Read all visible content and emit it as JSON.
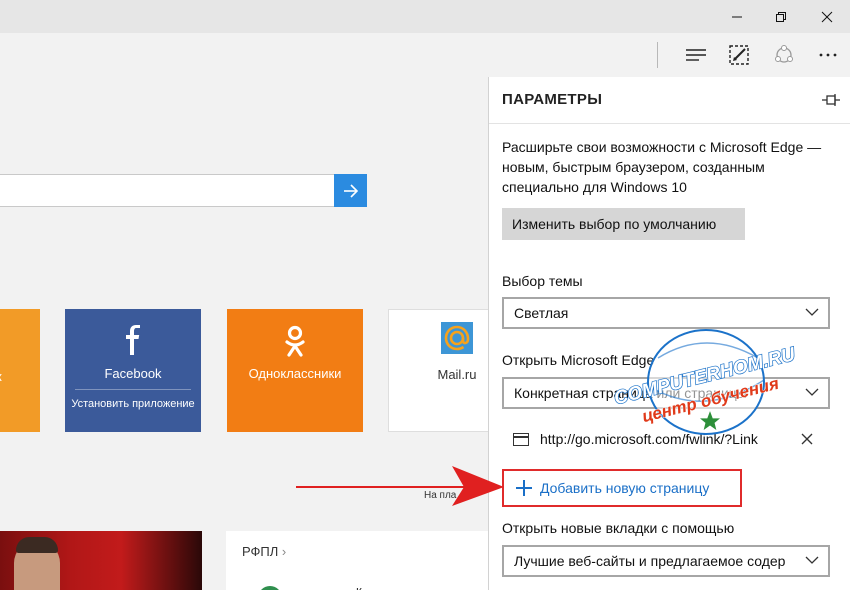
{
  "window": {
    "minimize_icon": "minimize-icon",
    "restore_icon": "restore-icon",
    "close_icon": "close-icon"
  },
  "toolbar": {
    "hub_icon": "hub-icon",
    "note_icon": "web-note-icon",
    "share_icon": "share-icon",
    "more_icon": "more-icon"
  },
  "page": {
    "search_value": "",
    "tiles": [
      {
        "label": "к"
      },
      {
        "label": "Facebook",
        "sub": "Установить приложение"
      },
      {
        "label": "Одноклассники"
      },
      {
        "label": "Mail.ru"
      }
    ],
    "platform_text": "На пла",
    "news_card_title": "РФПЛ",
    "news_card_fragment": "к"
  },
  "settings": {
    "title": "ПАРАМЕТРЫ",
    "promo": "Расширьте свои возможности с Microsoft Edge — новым, быстрым браузером, созданным специально для Windows 10",
    "default_button": "Изменить выбор по умолчанию",
    "theme_label": "Выбор темы",
    "theme_value": "Светлая",
    "open_label": "Открыть Microsoft Edge",
    "open_value": "Конкретная страница или страницы",
    "url": "http://go.microsoft.com/fwlink/?Link",
    "add_page": "Добавить новую страницу",
    "newtab_label": "Открыть новые вкладки с помощью",
    "newtab_value": "Лучшие веб-сайты и предлагаемое содер"
  },
  "watermark": {
    "line1": "COMPUTERHOM.RU",
    "line2": "центр обучения"
  },
  "colors": {
    "accent": "#2b8be0",
    "link": "#1a6fc7",
    "highlight": "#e02b2b",
    "facebook": "#3b5a9a",
    "ok": "#f27d14"
  }
}
